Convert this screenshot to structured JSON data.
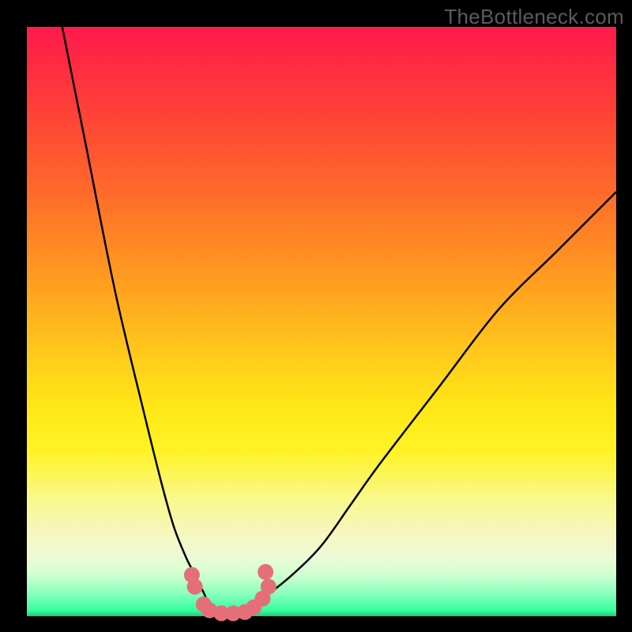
{
  "watermark": "TheBottleneck.com",
  "colors": {
    "background": "#000000",
    "curve": "#000000",
    "markers": "#e56f78",
    "gradient_top": "#ff1a4b",
    "gradient_bottom": "#18cc78"
  },
  "chart_data": {
    "type": "line",
    "title": "",
    "xlabel": "",
    "ylabel": "",
    "xlim": [
      0,
      100
    ],
    "ylim": [
      0,
      100
    ],
    "grid": false,
    "legend": false,
    "series": [
      {
        "name": "left-branch",
        "x": [
          6,
          10,
          15,
          20,
          23,
          25,
          27,
          28,
          29,
          30,
          31,
          33,
          35
        ],
        "y": [
          100,
          80,
          55,
          34,
          22,
          15,
          10,
          8,
          6,
          4,
          2,
          1,
          0
        ]
      },
      {
        "name": "right-branch",
        "x": [
          35,
          37,
          40,
          45,
          50,
          55,
          60,
          70,
          80,
          90,
          100
        ],
        "y": [
          0,
          1,
          3,
          7,
          12,
          19,
          26,
          39,
          52,
          62,
          72
        ]
      }
    ],
    "markers": [
      {
        "x": 28,
        "y": 7
      },
      {
        "x": 28.5,
        "y": 5
      },
      {
        "x": 30,
        "y": 2
      },
      {
        "x": 31,
        "y": 1
      },
      {
        "x": 33,
        "y": 0.5
      },
      {
        "x": 35,
        "y": 0.5
      },
      {
        "x": 37,
        "y": 0.7
      },
      {
        "x": 38.5,
        "y": 1.5
      },
      {
        "x": 40,
        "y": 3
      },
      {
        "x": 41,
        "y": 5
      },
      {
        "x": 40.5,
        "y": 7.5
      }
    ],
    "annotations": []
  }
}
